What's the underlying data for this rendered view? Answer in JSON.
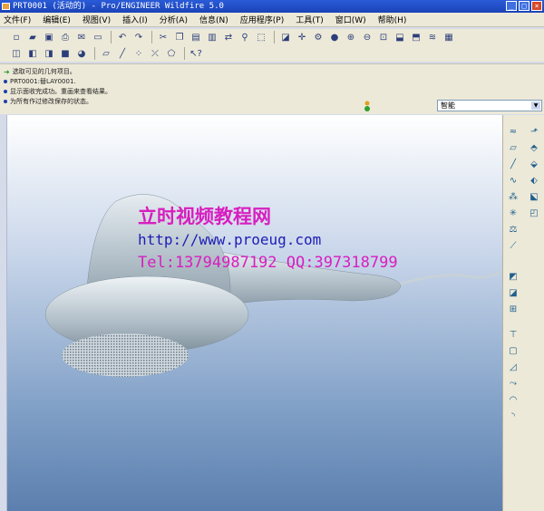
{
  "window": {
    "title": "PRT0001 (活动的) - Pro/ENGINEER Wildfire 5.0"
  },
  "menubar": {
    "items": [
      "文件(F)",
      "编辑(E)",
      "视图(V)",
      "插入(I)",
      "分析(A)",
      "信息(N)",
      "应用程序(P)",
      "工具(T)",
      "窗口(W)",
      "帮助(H)"
    ]
  },
  "messages": [
    "选取可见的几何项目。",
    "PRT0001:替LAY0001.",
    "显示面收完成功。重画来查看结果。",
    "为所有作过修改保存的状态。"
  ],
  "filter": {
    "value": "智能"
  },
  "watermark": {
    "line1": "立时视频教程网",
    "line2": "http://www.proeug.com",
    "line3": "Tel:13794987192  QQ:397318799"
  },
  "colors": {
    "accent_title": "#1a43b8",
    "watermark_pink": "#d81ec0",
    "watermark_blue": "#1d1db5",
    "model": "#b8c5cf"
  }
}
